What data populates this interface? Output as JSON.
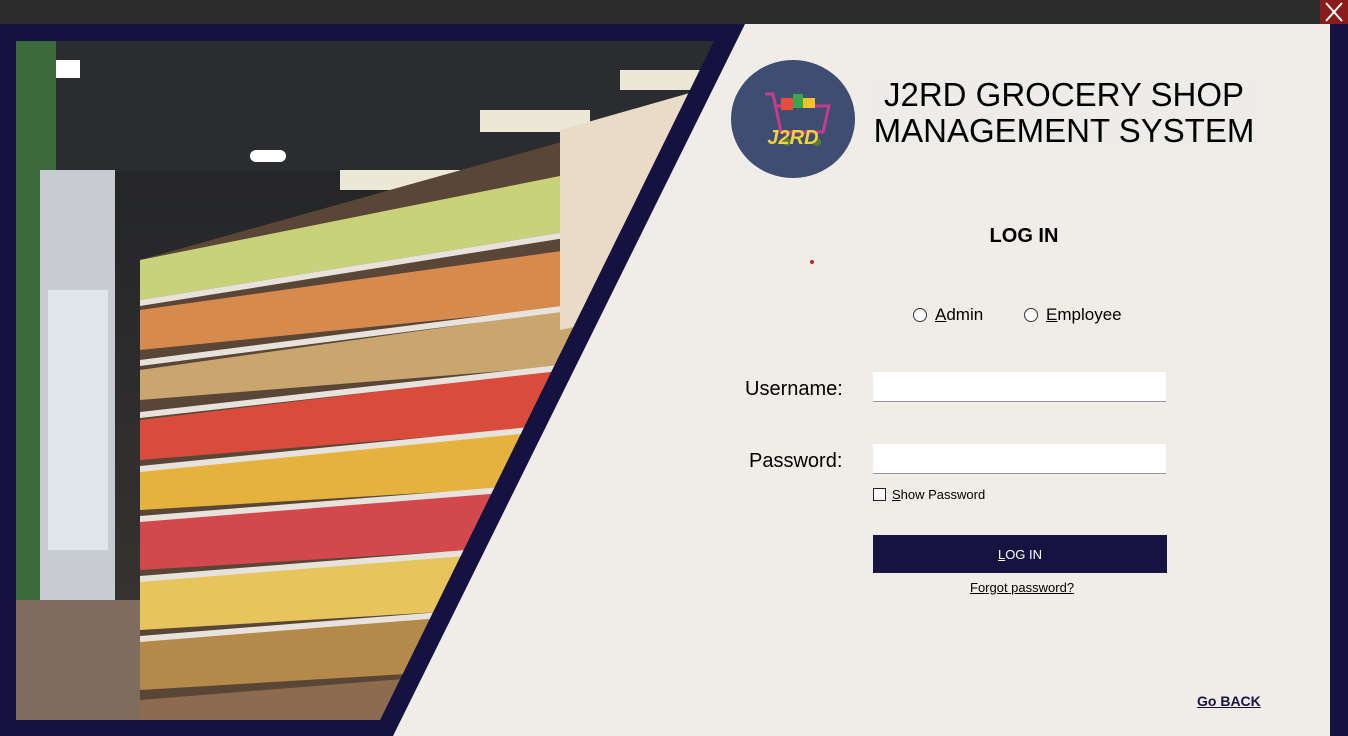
{
  "window": {
    "close_icon": "close-icon"
  },
  "brand": {
    "logo_text": "J2RD",
    "title_line1": "J2RD GROCERY SHOP",
    "title_line2": "MANAGEMENT SYSTEM"
  },
  "login": {
    "heading": "LOG IN",
    "roles": [
      {
        "accel": "A",
        "rest": "dmin"
      },
      {
        "accel": "E",
        "rest": "mployee"
      }
    ],
    "username_label": "Username:",
    "username_value": "",
    "password_label": "Password:",
    "password_value": "",
    "show_password_accel": "S",
    "show_password_rest": "how Password",
    "button_accel": "L",
    "button_rest": "OG IN",
    "forgot_label": "Forgot password?",
    "go_back_label": "Go BACK"
  },
  "colors": {
    "frame": "#151240",
    "background": "#f0ece8",
    "logo_bg": "#3d4e72",
    "close": "#8b1a1a",
    "button": "#161340"
  }
}
